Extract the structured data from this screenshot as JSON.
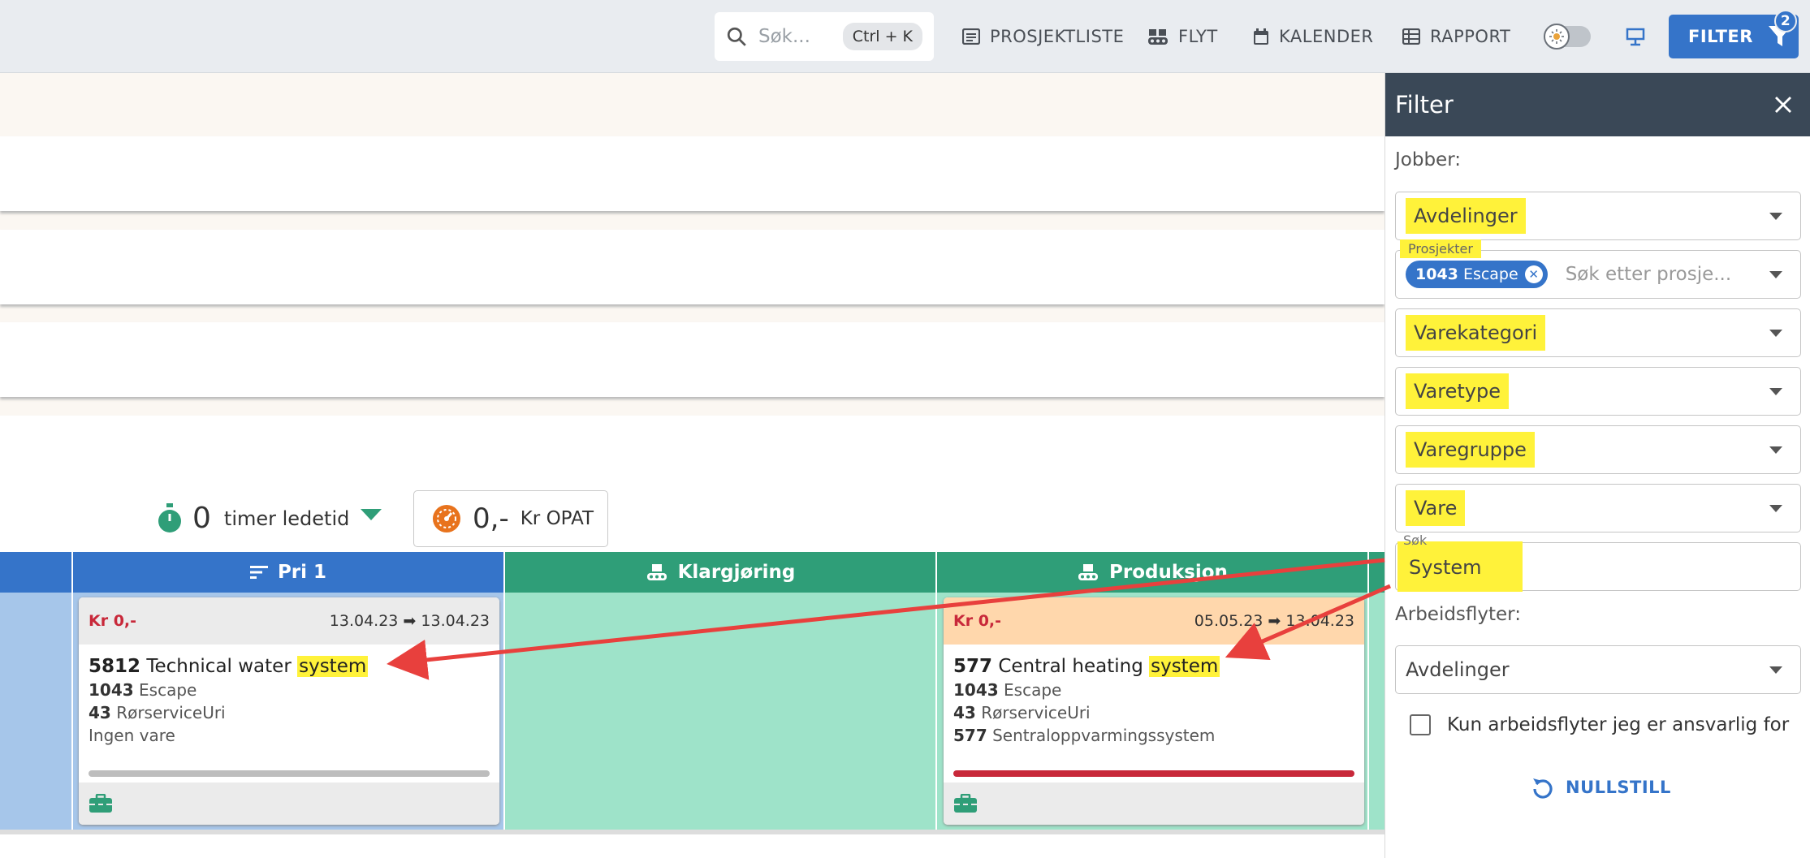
{
  "topbar": {
    "search_placeholder": "Søk...",
    "search_shortcut": "Ctrl + K",
    "nav": [
      {
        "label": "PROSJEKTLISTE",
        "icon": "list-card-icon"
      },
      {
        "label": "FLYT",
        "icon": "conveyor-icon"
      },
      {
        "label": "KALENDER",
        "icon": "calendar-icon"
      },
      {
        "label": "RAPPORT",
        "icon": "table-icon"
      }
    ],
    "filter_label": "FILTER",
    "filter_count": "2"
  },
  "metrics": {
    "lead_value": "0",
    "lead_label": "timer ledetid",
    "opat_value": "0,-",
    "opat_label": "Kr OPAT"
  },
  "columns": [
    {
      "label": "Pri 1",
      "color": "#3574c9"
    },
    {
      "label": "Klargjøring",
      "color": "#2f9e78"
    },
    {
      "label": "Produksjon",
      "color": "#2f9e78"
    }
  ],
  "cards": [
    {
      "price": "Kr 0,-",
      "dates": "13.04.23 ➡ 13.04.23",
      "job_no": "5812",
      "title_text": "Technical water",
      "title_highlight": "system",
      "project_no": "1043",
      "project_name": "Escape",
      "customer_no": "43",
      "customer_name": "RørserviceUri",
      "item_no": "",
      "item_name": "Ingen vare"
    },
    {
      "price": "Kr 0,-",
      "dates": "05.05.23 ➡ 13.04.23",
      "job_no": "577",
      "title_text": "Central heating",
      "title_highlight": "system",
      "project_no": "1043",
      "project_name": "Escape",
      "customer_no": "43",
      "customer_name": "RørserviceUri",
      "item_no": "577",
      "item_name": "Sentraloppvarmingssystem"
    }
  ],
  "filter_panel": {
    "title": "Filter",
    "jobs_label": "Jobber:",
    "avdelinger": "Avdelinger",
    "prosjekter_label": "Prosjekter",
    "chip_no": "1043",
    "chip_name": "Escape",
    "prosjekter_placeholder": "Søk etter prosje...",
    "varekategori": "Varekategori",
    "varetype": "Varetype",
    "varegruppe": "Varegruppe",
    "vare": "Vare",
    "sok_label": "Søk",
    "sok_value": "System",
    "workflows_label": "Arbeidsflyter:",
    "wf_avdelinger": "Avdelinger",
    "checkbox_label": "Kun arbeidsflyter jeg er ansvarlig for",
    "reset_label": "NULLSTILL"
  }
}
